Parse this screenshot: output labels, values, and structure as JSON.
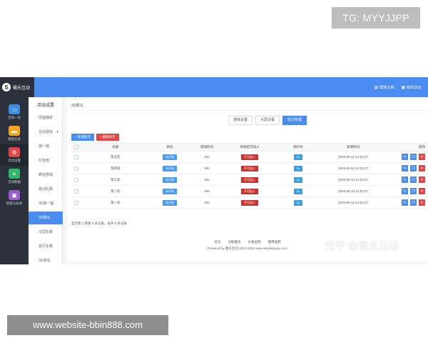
{
  "watermarks": {
    "top_right": "TG: MYYJJPP",
    "bottom_left": "www.website-bbin888.com",
    "zhihu": "知乎 @蜀乐互动"
  },
  "app": {
    "logo_text": "蜀乐互动",
    "top_links": [
      {
        "label": "帮助文档",
        "icon": "book-icon"
      },
      {
        "label": "我的活动",
        "icon": "grid-icon"
      }
    ],
    "rail": [
      {
        "label": "活动一览",
        "icon": "monitor-icon",
        "color": "#3a8ee6"
      },
      {
        "label": "基础信息",
        "icon": "folder-icon",
        "color": "#f5a623"
      },
      {
        "label": "活动设置",
        "icon": "gear-icon",
        "color": "#e04848"
      },
      {
        "label": "活动数据",
        "icon": "database-icon",
        "color": "#2fb86c"
      },
      {
        "label": "链接与安卓",
        "icon": "apps-icon",
        "color": "#9b59d0"
      }
    ],
    "submenu": {
      "title": "活动设置",
      "items": [
        {
          "label": "页面抽奖"
        },
        {
          "label": "互动游戏",
          "has_arrow": true
        },
        {
          "label": "摇一摇"
        },
        {
          "label": "红包雨"
        },
        {
          "label": "疯狂数钱"
        },
        {
          "label": "拔河比赛"
        },
        {
          "label": "3D摇一摇"
        },
        {
          "label": "3D赛马",
          "active": true
        },
        {
          "label": "马拉松赛"
        },
        {
          "label": "自行车赛"
        },
        {
          "label": "3D游泳"
        }
      ]
    },
    "breadcrumb": "3D赛马",
    "tabs": [
      {
        "label": "游戏设置"
      },
      {
        "label": "大屏设置"
      },
      {
        "label": "轮次管理",
        "active": true
      }
    ],
    "actions": {
      "add": "+ 新增轮次",
      "delete": "删除轮次"
    },
    "table": {
      "headers": [
        "标题",
        "状态",
        "游戏时间",
        "开始后可加入",
        "倒计时",
        "新建时间",
        "操作"
      ],
      "rows": [
        {
          "title": "第五轮",
          "status": "未开始",
          "time": "30s",
          "join": "不可加入",
          "countdown": "5s",
          "created": "2020-08-10 14:01:27"
        },
        {
          "title": "第四轮",
          "status": "未开始",
          "time": "30s",
          "join": "不可加入",
          "countdown": "5s",
          "created": "2020-08-10 14:01:27"
        },
        {
          "title": "第三轮",
          "status": "未开始",
          "time": "30s",
          "join": "不可加入",
          "countdown": "5s",
          "created": "2020-08-10 14:01:27"
        },
        {
          "title": "第二轮",
          "status": "未开始",
          "time": "30s",
          "join": "不可加入",
          "countdown": "5s",
          "created": "2020-08-10 14:01:27"
        },
        {
          "title": "第一轮",
          "status": "未开始",
          "time": "30s",
          "join": "不可加入",
          "countdown": "5s",
          "created": "2020-08-10 14:01:27"
        }
      ]
    },
    "page_info": "显示第 1 到第 5 条记录，总共 5 条记录",
    "footer": {
      "links": [
        "首页",
        "功能模块",
        "价格说明",
        "使用说明"
      ],
      "copyright": "Powered by 蜀乐互动 2013-2020 www.weiyaoyiyao.com"
    },
    "colors": {
      "topbar": "#4a8cf0",
      "rail": "#2b303a",
      "accent": "#4a8cf0",
      "danger": "#c83434"
    }
  }
}
